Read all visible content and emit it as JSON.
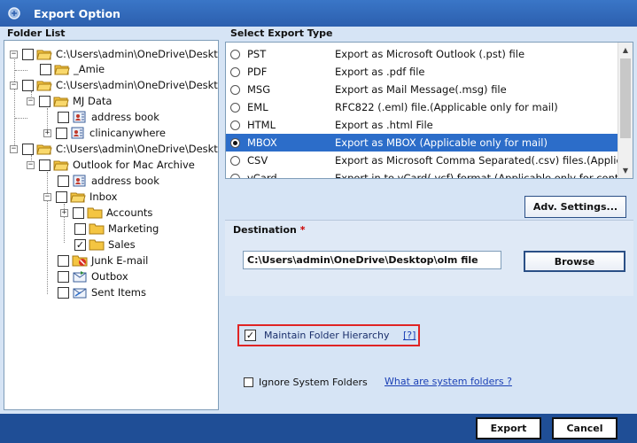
{
  "window": {
    "title": "Export Option"
  },
  "folder_list": {
    "header": "Folder List",
    "items": [
      {
        "label": "C:\\Users\\admin\\OneDrive\\Desktop"
      },
      {
        "label": "_Amie"
      },
      {
        "label": "C:\\Users\\admin\\OneDrive\\Desktop"
      },
      {
        "label": "MJ Data"
      },
      {
        "label": "address book"
      },
      {
        "label": "clinicanywhere"
      },
      {
        "label": "C:\\Users\\admin\\OneDrive\\Desktop"
      },
      {
        "label": "Outlook for Mac Archive"
      },
      {
        "label": "address book"
      },
      {
        "label": "Inbox"
      },
      {
        "label": "Accounts"
      },
      {
        "label": "Marketing"
      },
      {
        "label": "Sales"
      },
      {
        "label": "Junk E-mail"
      },
      {
        "label": "Outbox"
      },
      {
        "label": "Sent Items"
      }
    ]
  },
  "export_type": {
    "header": "Select Export Type",
    "options": [
      {
        "name": "PST",
        "desc": "Export as Microsoft Outlook (.pst) file"
      },
      {
        "name": "PDF",
        "desc": "Export as .pdf file"
      },
      {
        "name": "MSG",
        "desc": "Export as Mail Message(.msg) file"
      },
      {
        "name": "EML",
        "desc": "RFC822 (.eml) file.(Applicable only for mail)"
      },
      {
        "name": "HTML",
        "desc": "Export as .html File"
      },
      {
        "name": "MBOX",
        "desc": "Export as MBOX (Applicable only for mail)"
      },
      {
        "name": "CSV",
        "desc": "Export as Microsoft Comma Separated(.csv) files.(Applicable ..."
      },
      {
        "name": "vCard",
        "desc": "Export in to vCard(.vcf) format.(Applicable only for contact)"
      }
    ],
    "selected": "MBOX"
  },
  "adv_settings_label": "Adv. Settings...",
  "destination": {
    "label": "Destination",
    "required_mark": "*",
    "path": "C:\\Users\\admin\\OneDrive\\Desktop\\olm file",
    "browse_label": "Browse"
  },
  "options": {
    "maintain_hierarchy_label": "Maintain Folder Hierarchy",
    "maintain_hierarchy_help": "[?]",
    "ignore_system_label": "Ignore System Folders",
    "system_folders_link": "What are system folders ?"
  },
  "footer": {
    "export_label": "Export",
    "cancel_label": "Cancel"
  },
  "colors": {
    "selection": "#2c6dc9",
    "titlebar": "#2c5fae",
    "highlight_box": "#e02424"
  }
}
